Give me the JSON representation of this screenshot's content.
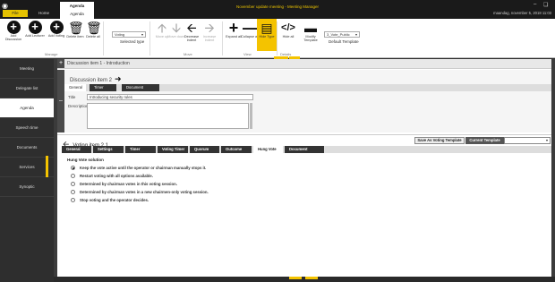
{
  "window": {
    "title": "November update meeting - Meeting Manager",
    "context_tab": "Agenda",
    "datetime": "maandag, november 5, 2018 11:03"
  },
  "ribbon_tabs": {
    "file": "File",
    "home": "Home",
    "agenda": "Agenda"
  },
  "ribbon": {
    "add_discussion": "Add Discussion",
    "add_lecturer": "Add Lecturer",
    "add_voting": "Add Voting",
    "delete_item": "Delete item",
    "delete_all": "Delete all",
    "group_manage": "Manage",
    "voting_type_value": "Voting",
    "selected_type": "Selected type",
    "move_up": "Move up",
    "move_down": "Move down",
    "decrease_indent": "Decrease indent",
    "increase_indent": "Increase indent",
    "group_move": "Move",
    "expand_all": "Expand all",
    "collapse_all": "Collapse all",
    "hide_type": "Hide Type",
    "group_view": "View",
    "hide_all": "Hide all",
    "modify_template": "Modify Template",
    "group_details": "Details",
    "template_value": "3_Vote_Public",
    "default_template": "Default Template"
  },
  "sidebar": {
    "items": [
      {
        "label": "Meeting"
      },
      {
        "label": "Delegate list"
      },
      {
        "label": "Agenda"
      },
      {
        "label": "Speech time"
      },
      {
        "label": "Documents"
      },
      {
        "label": "Services"
      },
      {
        "label": "Synoptic"
      }
    ]
  },
  "agenda": {
    "discussion1": "Discussion item 1 - Introduction",
    "discussion2": {
      "title": "Discussion item 2",
      "tabs": [
        "General",
        "Timer",
        "Document"
      ],
      "title_label": "Title",
      "title_value": "Introducing security rules",
      "description_label": "Description"
    },
    "voting": {
      "title": "Voting item 2.1",
      "save_template": "Save As Voting Template",
      "current_template": "Current Template",
      "tabs": [
        "General",
        "Settings",
        "Timer",
        "Voting Timer",
        "Quorum",
        "Outcome",
        "Hung Vote",
        "Document"
      ],
      "hung_vote_heading": "Hung Vote solution",
      "options": [
        "Keep the vote active until the operator or chairman manually stops it.",
        "Restart voting with all options available.",
        "Determined by chairman votes in this voting session.",
        "Determined by chairman votes in a new chairmen-only voting session.",
        "Stop voting and the operator decides."
      ],
      "selected_option": 0
    }
  },
  "colors": {
    "accent": "#f4c300",
    "dark": "#2e2e2e"
  }
}
